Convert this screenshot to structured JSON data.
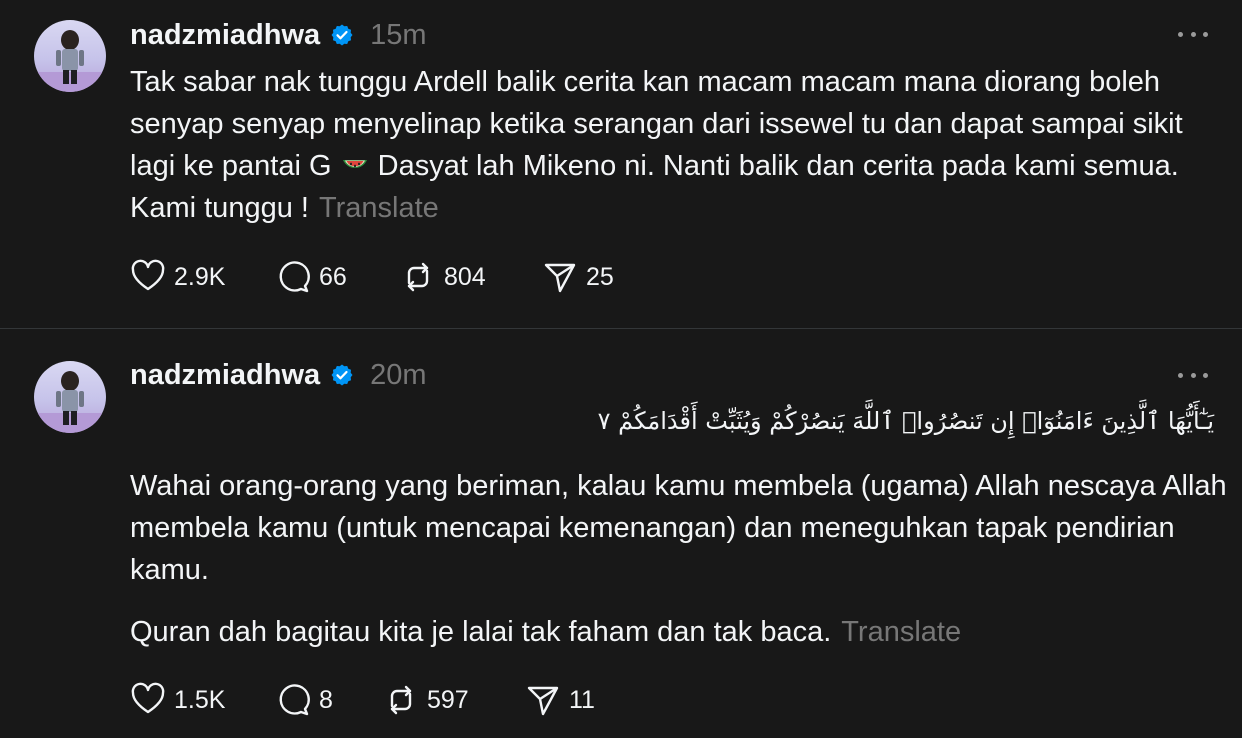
{
  "posts": [
    {
      "username": "nadzmiadhwa",
      "time": "15m",
      "text_before_emoji": "Tak sabar nak tunggu Ardell balik cerita kan macam macam mana diorang boleh senyap senyap menyelinap ketika serangan dari issewel tu dan dapat sampai sikit lagi ke pantai G",
      "emoji": "watermelon-icon",
      "text_after_emoji": " Dasyat lah Mikeno ni. Nanti balik dan cerita pada kami semua. Kami tunggu !",
      "translate_label": "Translate",
      "likes": "2.9K",
      "replies": "66",
      "reposts": "804",
      "shares": "25"
    },
    {
      "username": "nadzmiadhwa",
      "time": "20m",
      "arabic": "يَـٰٓأَيُّهَا ٱلَّذِينَ ءَامَنُوٓا۟ إِن تَنصُرُوا۟ ٱللَّهَ يَنصُرْكُمْ وَيُثَبِّتْ أَقْدَامَكُمْ ٧",
      "paragraph_1": "Wahai orang-orang yang beriman, kalau kamu membela (ugama) Allah nescaya Allah membela kamu (untuk mencapai kemenangan) dan meneguhkan tapak pendirian kamu.",
      "paragraph_2": "Quran dah bagitau kita je lalai tak faham dan tak baca.",
      "translate_label": "Translate",
      "likes": "1.5K",
      "replies": "8",
      "reposts": "597",
      "shares": "11"
    }
  ],
  "colors": {
    "background": "#181818",
    "text": "#f3f5f7",
    "muted": "#777777",
    "verified": "#0095f6",
    "divider": "#333638"
  }
}
